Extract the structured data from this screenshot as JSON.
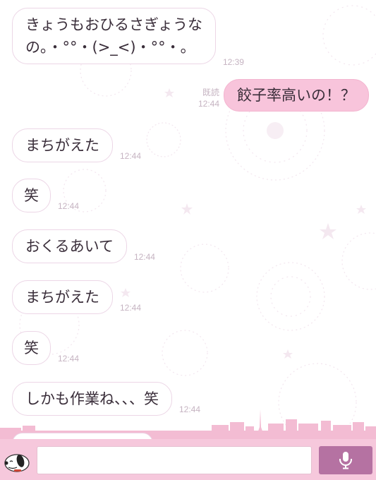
{
  "messages": [
    {
      "side": "in",
      "lines": [
        "きょうもおひるさぎょうな",
        "の。・°°・(>_<)・°°・。"
      ],
      "time": "12:39"
    },
    {
      "side": "out",
      "lines": [
        "餃子率高いの！？"
      ],
      "read": "既読",
      "time": "12:44"
    },
    {
      "side": "in",
      "lines": [
        "まちがえた"
      ],
      "time": "12:44"
    },
    {
      "side": "in",
      "lines": [
        "笑"
      ],
      "time": "12:44"
    },
    {
      "side": "in",
      "lines": [
        "おくるあいて"
      ],
      "time": "12:44"
    },
    {
      "side": "in",
      "lines": [
        "まちがえた"
      ],
      "time": "12:44"
    },
    {
      "side": "in",
      "lines": [
        "笑"
      ],
      "time": "12:44"
    },
    {
      "side": "in",
      "lines": [
        "しかも作業ね、、、笑"
      ],
      "time": "12:44"
    }
  ],
  "input_bar": {
    "placeholder": "",
    "value": "",
    "avatar_icon": "snoopy-avatar-icon",
    "mic_icon": "microphone-icon"
  },
  "colors": {
    "accent": "#b572a2",
    "outgoing_bubble": "#f8c4db",
    "incoming_border": "#ecd6e6",
    "input_bar": "#f6c8dc",
    "skyline": "#f3bcd3"
  }
}
